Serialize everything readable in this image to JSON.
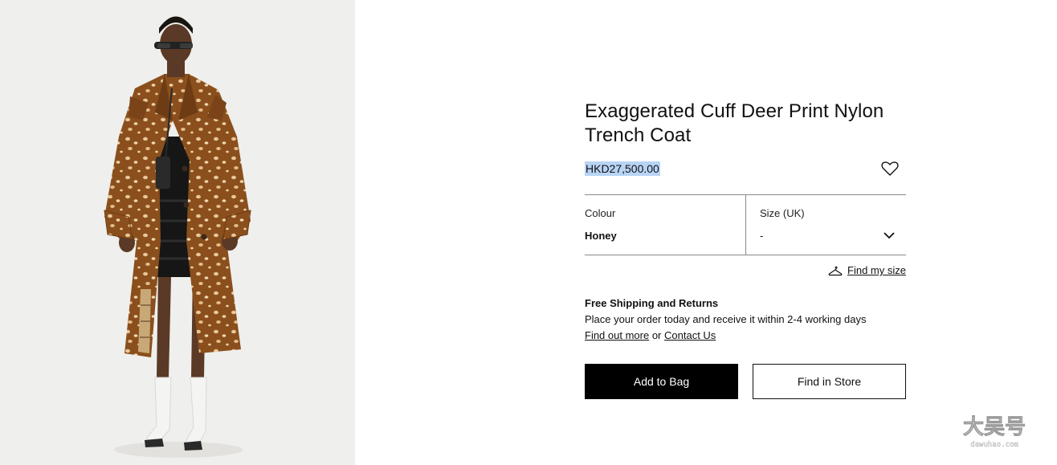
{
  "product": {
    "title_line1": "Exaggerated Cuff Deer Print Nylon",
    "title_line2": "Trench Coat",
    "price": "HKD27,500.00",
    "image_alt": "Model wearing deer print nylon trench coat",
    "print_colors": {
      "base": "#8a4f1c",
      "spot": "#e8c79a",
      "skirt": "#161616"
    }
  },
  "selectors": {
    "colour_label": "Colour",
    "colour_value": "Honey",
    "size_label": "Size (UK)",
    "size_value": "-"
  },
  "find_size": {
    "label": "Find my size"
  },
  "shipping": {
    "title": "Free Shipping and Returns",
    "text": "Place your order today and receive it within 2-4 working days",
    "link_more": "Find out more",
    "or_text": " or ",
    "link_contact": "Contact Us"
  },
  "actions": {
    "add_to_bag": "Add to Bag",
    "find_in_store": "Find in Store"
  },
  "watermark": {
    "text": "大吴号",
    "subtext": "dawuhao.com"
  }
}
